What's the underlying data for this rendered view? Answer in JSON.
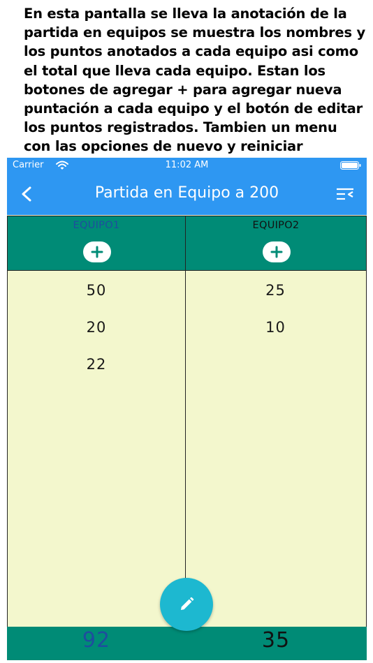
{
  "caption": "En esta pantalla se lleva la anotación  de la partida en equipos se muestra los nombres y los puntos anotados a cada equipo asi como el total que lleva cada equipo. Estan los botones de agregar + para agregar nueva puntación a cada equipo y el botón de editar los puntos registrados. Tambien un menu con las opciones de nuevo y reiniciar apuntes.",
  "status_bar": {
    "carrier": "Carrier",
    "time": "11:02 AM"
  },
  "nav": {
    "title": "Partida en Equipo a 200",
    "back_icon": "chevron-left-icon",
    "menu_icon": "menu-icon"
  },
  "teams": [
    {
      "name": "EQUIPO1",
      "name_color": "#1f4d9e",
      "scores": [
        "50",
        "20",
        "22"
      ],
      "total": "92",
      "total_color": "#1f4d9e"
    },
    {
      "name": "EQUIPO2",
      "name_color": "#111111",
      "scores": [
        "25",
        "10"
      ],
      "total": "35",
      "total_color": "#111111"
    }
  ],
  "colors": {
    "nav_blue": "#2e97f2",
    "header_teal": "#008b76",
    "score_bg": "#f3f7cd",
    "fab_cyan": "#1db8d0"
  },
  "fab_icon": "pencil-icon",
  "add_icon": "plus-icon"
}
